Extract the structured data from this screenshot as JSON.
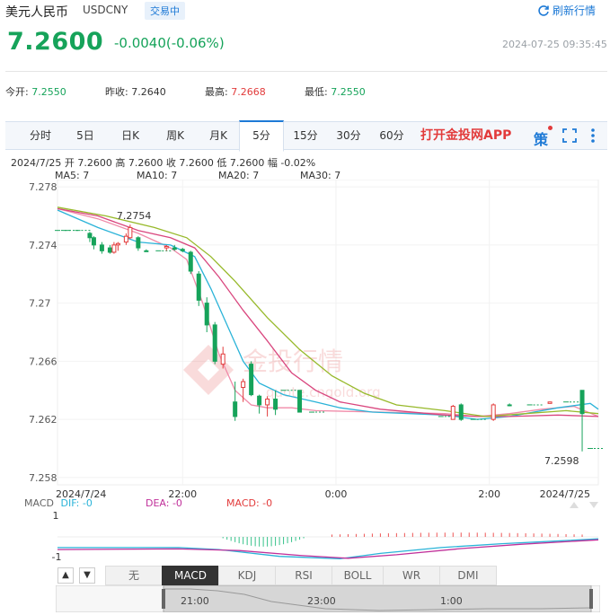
{
  "header": {
    "title": "美元人民币",
    "code": "USDCNY",
    "status": "交易中",
    "refresh_label": "刷新行情"
  },
  "quote": {
    "price": "7.2600",
    "change": "-0.0040(-0.06%)",
    "timestamp": "2024-07-25 09:35:45"
  },
  "stats": {
    "open_label": "今开:",
    "open_value": "7.2550",
    "prev_close_label": "昨收:",
    "prev_close_value": "7.2640",
    "high_label": "最高:",
    "high_value": "7.2668",
    "low_label": "最低:",
    "low_value": "7.2550"
  },
  "tabs": [
    {
      "label": "分时"
    },
    {
      "label": "5日"
    },
    {
      "label": "日K"
    },
    {
      "label": "周K"
    },
    {
      "label": "月K"
    },
    {
      "label": "5分",
      "active": true
    },
    {
      "label": "15分"
    },
    {
      "label": "30分"
    },
    {
      "label": "60分"
    }
  ],
  "app_link": "打开金投网APP",
  "toolbar_icons": [
    "strategy-icon",
    "fullscreen-icon",
    "more-icon"
  ],
  "strategy_label": "策",
  "candle_info": "2024/7/25  开 7.2600  高 7.2600  收 7.2600  低 7.2600  幅 -0.02%",
  "ma_legend": [
    {
      "label": "MA5: 7",
      "color": "#f08aa8"
    },
    {
      "label": "MA10: 7",
      "color": "#2ab3d8"
    },
    {
      "label": "MA20: 7",
      "color": "#d9467e"
    },
    {
      "label": "MA30: 7",
      "color": "#97b92a"
    }
  ],
  "watermark": {
    "text": "金投行情",
    "sub": "quote.cngold.org"
  },
  "macd_legend": {
    "title": "MACD",
    "dif": "DIF: -0",
    "dea": "DEA: -0",
    "macd": "MACD: -0",
    "y_top": "1",
    "y_bottom": "-1"
  },
  "indicator_tabs": [
    {
      "label": "无"
    },
    {
      "label": "MACD",
      "active": true
    },
    {
      "label": "KDJ"
    },
    {
      "label": "RSI"
    },
    {
      "label": "BOLL"
    },
    {
      "label": "WR"
    },
    {
      "label": "DMI"
    }
  ],
  "scroll_labels": [
    "21:00",
    "23:00",
    "1:00"
  ],
  "chart_data": {
    "type": "candlestick",
    "y_ticks": [
      "7.278",
      "7.274",
      "7.27",
      "7.266",
      "7.262",
      "7.258"
    ],
    "ylim": [
      7.2575,
      7.2785
    ],
    "x_ticks": [
      {
        "label": "2024/7/24",
        "i": 0
      },
      {
        "label": "22:00",
        "i": 31
      },
      {
        "label": "0:00",
        "i": 69
      },
      {
        "label": "2:00",
        "i": 107
      },
      {
        "label": "2024/7/25",
        "i": 132
      }
    ],
    "annotations": [
      {
        "label": "7.2754",
        "i": 18,
        "value": 7.2754
      },
      {
        "label": "7.2598",
        "i": 131,
        "value": 7.2598
      }
    ],
    "candles": [
      [
        0,
        7.275,
        7.275,
        7.275,
        7.275
      ],
      [
        2,
        7.275,
        7.275,
        7.275,
        7.275
      ],
      [
        5,
        7.275,
        7.275,
        7.275,
        7.275
      ],
      [
        8,
        7.2748,
        7.2749,
        7.2742,
        7.2745
      ],
      [
        9,
        7.2745,
        7.2746,
        7.2737,
        7.274
      ],
      [
        11,
        7.274,
        7.2742,
        7.2734,
        7.2736
      ],
      [
        13,
        7.2738,
        7.274,
        7.2734,
        7.2735
      ],
      [
        14,
        7.2735,
        7.2742,
        7.2734,
        7.274
      ],
      [
        15,
        7.274,
        7.2742,
        7.2736,
        7.2741
      ],
      [
        17,
        7.2742,
        7.2748,
        7.274,
        7.2746
      ],
      [
        18,
        7.2745,
        7.2754,
        7.2744,
        7.2752
      ],
      [
        20,
        7.2745,
        7.2746,
        7.2736,
        7.2738
      ],
      [
        22,
        7.2736,
        7.2737,
        7.2736,
        7.2736
      ],
      [
        25,
        7.2736,
        7.2736,
        7.2736,
        7.2736
      ],
      [
        27,
        7.2738,
        7.274,
        7.2736,
        7.2739
      ],
      [
        29,
        7.2738,
        7.274,
        7.2736,
        7.2737
      ],
      [
        31,
        7.2737,
        7.2738,
        7.2735,
        7.2736
      ],
      [
        33,
        7.2735,
        7.2736,
        7.272,
        7.2722
      ],
      [
        35,
        7.272,
        7.2722,
        7.2698,
        7.2702
      ],
      [
        37,
        7.27,
        7.2704,
        7.268,
        7.2685
      ],
      [
        39,
        7.2685,
        7.2687,
        7.2658,
        7.266
      ],
      [
        41,
        7.2658,
        7.267,
        7.2655,
        7.2665
      ],
      [
        44,
        7.2632,
        7.2646,
        7.2619,
        7.2622
      ],
      [
        46,
        7.2642,
        7.2648,
        7.2632,
        7.2646
      ],
      [
        48,
        7.2658,
        7.266,
        7.2636,
        7.2637
      ],
      [
        50,
        7.2636,
        7.2637,
        7.2624,
        7.263
      ],
      [
        52,
        7.263,
        7.2636,
        7.2622,
        7.2634
      ],
      [
        54,
        7.2634,
        7.264,
        7.2623,
        7.2627
      ],
      [
        56,
        7.264,
        7.264,
        7.264,
        7.264
      ],
      [
        60,
        7.264,
        7.264,
        7.2625,
        7.2625
      ],
      [
        63,
        7.2625,
        7.2625,
        7.2625,
        7.2625
      ],
      [
        95,
        7.2622,
        7.2622,
        7.2622,
        7.2622
      ],
      [
        98,
        7.262,
        7.263,
        7.262,
        7.2629
      ],
      [
        100,
        7.263,
        7.2631,
        7.2619,
        7.262
      ],
      [
        103,
        7.262,
        7.262,
        7.262,
        7.262
      ],
      [
        108,
        7.262,
        7.2631,
        7.2619,
        7.263
      ],
      [
        112,
        7.263,
        7.2631,
        7.2629,
        7.263
      ],
      [
        117,
        7.263,
        7.263,
        7.263,
        7.263
      ],
      [
        122,
        7.2631,
        7.2632,
        7.2631,
        7.2632
      ],
      [
        126,
        7.2632,
        7.2632,
        7.2632,
        7.2632
      ],
      [
        130,
        7.264,
        7.264,
        7.2598,
        7.2624
      ],
      [
        132,
        7.26,
        7.26,
        7.26,
        7.26
      ]
    ],
    "ma_lines": {
      "MA5": [
        [
          0,
          7.2765
        ],
        [
          10,
          7.2758
        ],
        [
          20,
          7.2748
        ],
        [
          28,
          7.2738
        ],
        [
          32,
          7.273
        ],
        [
          36,
          7.27
        ],
        [
          40,
          7.2665
        ],
        [
          44,
          7.264
        ],
        [
          48,
          7.263
        ],
        [
          52,
          7.2628
        ],
        [
          58,
          7.2628
        ],
        [
          64,
          7.2626
        ],
        [
          80,
          7.2625
        ],
        [
          96,
          7.2624
        ],
        [
          104,
          7.2622
        ],
        [
          112,
          7.2624
        ],
        [
          120,
          7.2627
        ],
        [
          128,
          7.2629
        ],
        [
          134,
          7.2622
        ]
      ],
      "MA10": [
        [
          0,
          7.2764
        ],
        [
          10,
          7.2752
        ],
        [
          20,
          7.2742
        ],
        [
          28,
          7.274
        ],
        [
          34,
          7.2732
        ],
        [
          38,
          7.271
        ],
        [
          42,
          7.2685
        ],
        [
          46,
          7.266
        ],
        [
          50,
          7.2645
        ],
        [
          56,
          7.2637
        ],
        [
          64,
          7.2632
        ],
        [
          70,
          7.2628
        ],
        [
          78,
          7.2625
        ],
        [
          96,
          7.2623
        ],
        [
          104,
          7.262
        ],
        [
          112,
          7.2622
        ],
        [
          124,
          7.2628
        ],
        [
          132,
          7.2631
        ],
        [
          134,
          7.2627
        ]
      ],
      "MA20": [
        [
          0,
          7.2765
        ],
        [
          10,
          7.276
        ],
        [
          20,
          7.275
        ],
        [
          28,
          7.2745
        ],
        [
          34,
          7.2738
        ],
        [
          40,
          7.2718
        ],
        [
          46,
          7.2695
        ],
        [
          52,
          7.2674
        ],
        [
          58,
          7.2652
        ],
        [
          64,
          7.264
        ],
        [
          70,
          7.2632
        ],
        [
          80,
          7.2627
        ],
        [
          96,
          7.2623
        ],
        [
          104,
          7.2622
        ],
        [
          112,
          7.2622
        ],
        [
          124,
          7.2623
        ],
        [
          134,
          7.2622
        ]
      ],
      "MA30": [
        [
          0,
          7.2766
        ],
        [
          12,
          7.276
        ],
        [
          24,
          7.2752
        ],
        [
          32,
          7.2745
        ],
        [
          38,
          7.2732
        ],
        [
          44,
          7.2715
        ],
        [
          52,
          7.269
        ],
        [
          60,
          7.2668
        ],
        [
          68,
          7.265
        ],
        [
          76,
          7.2638
        ],
        [
          84,
          7.263
        ],
        [
          96,
          7.2626
        ],
        [
          106,
          7.2622
        ],
        [
          116,
          7.2624
        ],
        [
          126,
          7.2626
        ],
        [
          134,
          7.2624
        ]
      ]
    },
    "macd": {
      "dif": [
        [
          0,
          -0.55
        ],
        [
          30,
          -0.55
        ],
        [
          40,
          -0.65
        ],
        [
          55,
          -1.0
        ],
        [
          70,
          -1.12
        ],
        [
          80,
          -0.85
        ],
        [
          95,
          -0.55
        ],
        [
          110,
          -0.35
        ],
        [
          125,
          -0.2
        ],
        [
          134,
          -0.1
        ]
      ],
      "dea": [
        [
          0,
          -0.65
        ],
        [
          30,
          -0.62
        ],
        [
          45,
          -0.7
        ],
        [
          60,
          -0.95
        ],
        [
          72,
          -1.1
        ],
        [
          84,
          -0.92
        ],
        [
          100,
          -0.6
        ],
        [
          115,
          -0.38
        ],
        [
          128,
          -0.22
        ],
        [
          134,
          -0.15
        ]
      ],
      "hist_neg": [
        40,
        62
      ],
      "hist_pos": [
        68,
        130
      ]
    }
  }
}
